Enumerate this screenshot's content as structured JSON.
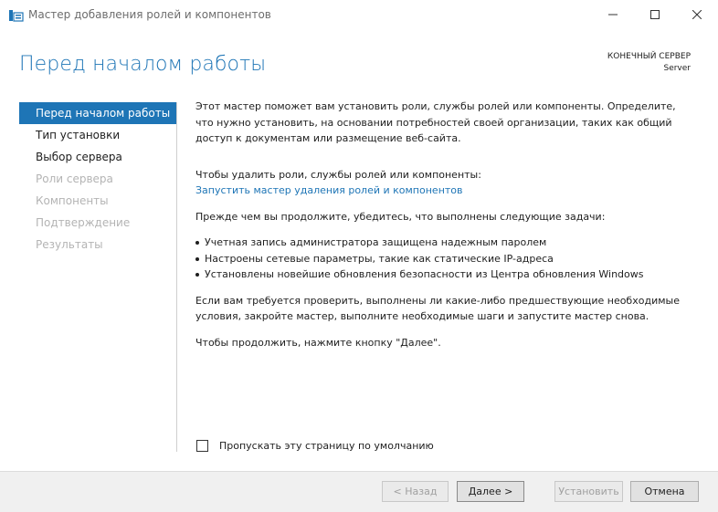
{
  "window": {
    "title": "Мастер добавления ролей и компонентов"
  },
  "header": {
    "title": "Перед началом работы",
    "destination_label": "КОНЕЧНЫЙ СЕРВЕР",
    "destination_value": "Server"
  },
  "nav": {
    "items": [
      {
        "label": "Перед началом работы",
        "state": "active"
      },
      {
        "label": "Тип установки",
        "state": "enabled"
      },
      {
        "label": "Выбор сервера",
        "state": "enabled"
      },
      {
        "label": "Роли сервера",
        "state": "disabled"
      },
      {
        "label": "Компоненты",
        "state": "disabled"
      },
      {
        "label": "Подтверждение",
        "state": "disabled"
      },
      {
        "label": "Результаты",
        "state": "disabled"
      }
    ]
  },
  "content": {
    "intro": "Этот мастер поможет вам установить роли, службы ролей или компоненты. Определите, что нужно установить, на основании потребностей своей организации, таких как общий доступ к документам или размещение веб-сайта.",
    "remove_text": "Чтобы удалить роли, службы ролей или компоненты:",
    "remove_link": "Запустить мастер удаления ролей и компонентов",
    "prereq_heading": "Прежде чем вы продолжите, убедитесь, что выполнены следующие задачи:",
    "bullets": [
      "Учетная запись администратора защищена надежным паролем",
      "Настроены сетевые параметры, такие как статические IP-адреса",
      "Установлены новейшие обновления безопасности из Центра обновления Windows"
    ],
    "verify_text": "Если вам требуется проверить, выполнены ли какие-либо предшествующие необходимые условия, закройте мастер, выполните необходимые шаги и запустите мастер снова.",
    "continue_text": "Чтобы продолжить, нажмите кнопку \"Далее\"."
  },
  "skip_checkbox": {
    "label": "Пропускать эту страницу по умолчанию",
    "checked": false
  },
  "buttons": {
    "back": "< Назад",
    "next": "Далее >",
    "install": "Установить",
    "cancel": "Отмена"
  },
  "colors": {
    "accent": "#1e75b6",
    "footer_bg": "#f0f0f0",
    "disabled_text": "#b4b4b4"
  }
}
